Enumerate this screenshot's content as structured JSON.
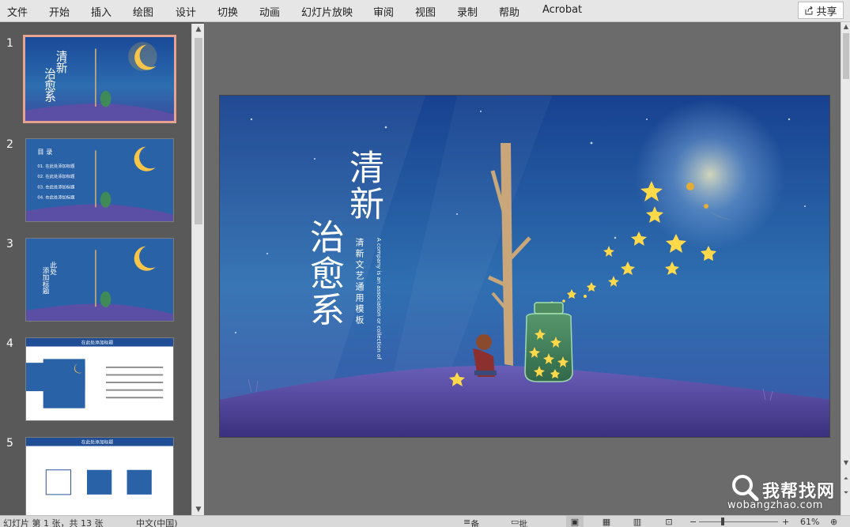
{
  "ribbon": {
    "tabs": [
      "文件",
      "开始",
      "插入",
      "绘图",
      "设计",
      "切换",
      "动画",
      "幻灯片放映",
      "审阅",
      "视图",
      "录制",
      "帮助",
      "Acrobat"
    ],
    "share_label": "共享"
  },
  "thumbnails": [
    {
      "number": "1",
      "selected": true,
      "kind": "cover"
    },
    {
      "number": "2",
      "selected": false,
      "kind": "contents",
      "heading": "目 录",
      "items": [
        "01. 在此处添加标题",
        "02. 在此处添加标题",
        "03. 在此处添加标题",
        "04. 在此处添加标题"
      ]
    },
    {
      "number": "3",
      "selected": false,
      "kind": "section",
      "heading": "此处",
      "subheading": "添加标题"
    },
    {
      "number": "4",
      "selected": false,
      "kind": "content",
      "heading": "在此处添加标题"
    },
    {
      "number": "5",
      "selected": false,
      "kind": "content",
      "heading": "在此处添加标题"
    }
  ],
  "slide": {
    "title_line1": "清新",
    "title_line2": "治愈系",
    "subtitle_cn": "清新文艺通用模板",
    "subtitle_en": "A company is an association or collection of individuals, whether natural persons, legal persons",
    "colors": {
      "sky_top": "#17418f",
      "sky_mid": "#2f6fb1",
      "hill": "#5b4fa5",
      "moon": "#f7c54a",
      "star": "#ffd94a"
    }
  },
  "statusbar": {
    "slide_info": "幻灯片 第 1 张，共 13 张",
    "language": "中文(中国)",
    "notes_label": "备注",
    "comments_label": "批注",
    "zoom": "61%"
  },
  "watermark": {
    "title": "我帮找网",
    "url": "wobangzhao.com"
  }
}
